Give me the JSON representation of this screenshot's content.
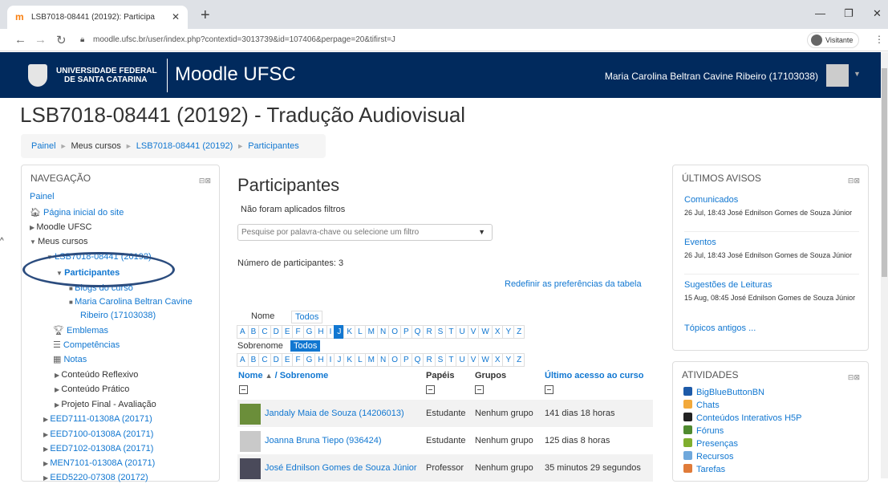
{
  "browser": {
    "tab_title": "LSB7018-08441 (20192): Participa",
    "url": "moodle.ufsc.br/user/index.php?contextid=3013739&id=107406&perpage=20&tifirst=J",
    "profile": "Visitante"
  },
  "header": {
    "uni_line1": "UNIVERSIDADE FEDERAL",
    "uni_line2": "DE SANTA CATARINA",
    "site": "Moodle UFSC",
    "user": "Maria Carolina Beltran Cavine Ribeiro (17103038)"
  },
  "page": {
    "title": "LSB7018-08441 (20192) - Tradução Audiovisual",
    "breadcrumb": [
      "Painel",
      "Meus cursos",
      "LSB7018-08441 (20192)",
      "Participantes"
    ]
  },
  "nav": {
    "title": "NAVEGAÇÃO",
    "items": [
      "Painel",
      "Página inicial do site",
      "Moodle UFSC",
      "Meus cursos",
      "LSB7018-08441 (20192)",
      "Participantes",
      "Blogs do curso",
      "Maria Carolina Beltran Cavine",
      "Ribeiro (17103038)",
      "Emblemas",
      "Competências",
      "Notas",
      "Conteúdo Reflexivo",
      "Conteúdo Prático",
      "Projeto Final - Avaliação",
      "EED7111-01308A (20171)",
      "EED7100-01308A (20171)",
      "EED7102-01308A (20171)",
      "MEN7101-01308A (20171)",
      "EED5220-07308 (20172)"
    ]
  },
  "main": {
    "title": "Participantes",
    "no_filters": "Não foram aplicados filtros",
    "filter_placeholder": "Pesquise por palavra-chave ou selecione um filtro",
    "count": "Número de participantes: 3",
    "reset": "Redefinir as preferências da tabela",
    "first_name_label": "Nome",
    "last_name_label": "Sobrenome",
    "all_label": "Todos",
    "letters": [
      "A",
      "B",
      "C",
      "D",
      "E",
      "F",
      "G",
      "H",
      "I",
      "J",
      "K",
      "L",
      "M",
      "N",
      "O",
      "P",
      "Q",
      "R",
      "S",
      "T",
      "U",
      "V",
      "W",
      "X",
      "Y",
      "Z"
    ],
    "first_name_selected": "J",
    "columns": {
      "name": "Nome",
      "name_sep": "/ Sobrenome",
      "roles": "Papéis",
      "groups": "Grupos",
      "last_access": "Último acesso ao curso"
    },
    "rows": [
      {
        "name": "Jandaly Maia de Souza (14206013)",
        "role": "Estudante",
        "group": "Nenhum grupo",
        "access": "141 dias 18 horas"
      },
      {
        "name": "Joanna Bruna Tiepo (936424)",
        "role": "Estudante",
        "group": "Nenhum grupo",
        "access": "125 dias 8 horas"
      },
      {
        "name": "José Ednilson Gomes de Souza Júnior",
        "role": "Professor",
        "group": "Nenhum grupo",
        "access": "35 minutos 29 segundos"
      }
    ]
  },
  "news": {
    "title": "ÚLTIMOS AVISOS",
    "items": [
      {
        "title": "Comunicados",
        "meta": "26 Jul, 18:43  José Ednilson Gomes de Souza Júnior"
      },
      {
        "title": "Eventos",
        "meta": "26 Jul, 18:43  José Ednilson Gomes de Souza Júnior"
      },
      {
        "title": "Sugestões de Leituras",
        "meta": "15 Aug, 08:45  José Ednilson Gomes de Souza Júnior"
      }
    ],
    "older": "Tópicos antigos ..."
  },
  "activities": {
    "title": "ATIVIDADES",
    "items": [
      {
        "label": "BigBlueButtonBN",
        "color": "#1d5aa8"
      },
      {
        "label": "Chats",
        "color": "#f2a93b"
      },
      {
        "label": "Conteúdos Interativos H5P",
        "color": "#222222"
      },
      {
        "label": "Fóruns",
        "color": "#4f8a2f"
      },
      {
        "label": "Presenças",
        "color": "#7fae2e"
      },
      {
        "label": "Recursos",
        "color": "#6fa8dc"
      },
      {
        "label": "Tarefas",
        "color": "#e07b39"
      }
    ]
  },
  "colors": {
    "header_bg": "#012a5d",
    "link": "#1177d1",
    "accent": "#1177d1"
  }
}
